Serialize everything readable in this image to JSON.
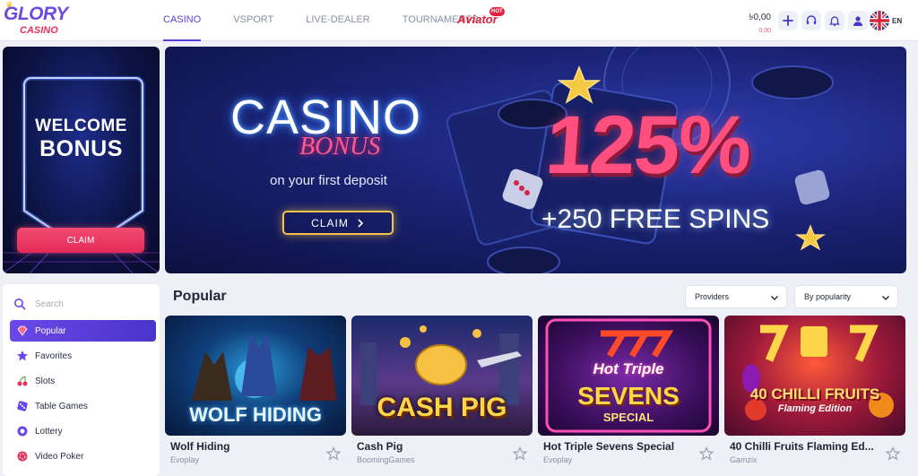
{
  "header": {
    "logo_top": "GLORY",
    "logo_bottom": "CASINO",
    "nav": [
      {
        "label": "CASINO",
        "active": true
      },
      {
        "label": "VSPORT",
        "active": false
      },
      {
        "label": "LIVE-DEALER",
        "active": false
      },
      {
        "label": "TOURNAMENTS",
        "active": false
      }
    ],
    "aviator": "Aviator",
    "aviator_badge": "HOT",
    "balance": "৳0,00",
    "bonus_balance": "0,00",
    "language": "EN"
  },
  "welcome": {
    "line1": "WELCOME",
    "line2": "BONUS",
    "claim": "CLAIM"
  },
  "banner": {
    "casino": "CASINO",
    "bonus": "BONUS",
    "subtitle": "on your first deposit",
    "claim": "CLAIM",
    "percent": "125%",
    "spins": "+250 FREE SPINS"
  },
  "sidebar": {
    "search_placeholder": "Search",
    "categories": [
      {
        "label": "Popular",
        "icon": "diamond-icon",
        "active": true
      },
      {
        "label": "Favorites",
        "icon": "star-icon",
        "active": false
      },
      {
        "label": "Slots",
        "icon": "cherries-icon",
        "active": false
      },
      {
        "label": "Table Games",
        "icon": "dice-icon",
        "active": false
      },
      {
        "label": "Lottery",
        "icon": "lottery-ball-icon",
        "active": false
      },
      {
        "label": "Video Poker",
        "icon": "poker-chip-icon",
        "active": false
      }
    ]
  },
  "games": {
    "section_title": "Popular",
    "providers_filter": "Providers",
    "sort_filter": "By popularity",
    "items": [
      {
        "name": "Wolf Hiding",
        "provider": "Evoplay",
        "art": "WOLF HIDING"
      },
      {
        "name": "Cash Pig",
        "provider": "BoomingGames",
        "art": "CASH PIG"
      },
      {
        "name": "Hot Triple Sevens Special",
        "provider": "Evoplay",
        "art1": "Hot Triple",
        "art2": "SEVENS",
        "art3": "SPECIAL"
      },
      {
        "name": "40 Chilli Fruits Flaming Ed...",
        "provider": "Gamzix",
        "art1": "40 CHILLI FRUITS",
        "art2": "Flaming Edition"
      }
    ]
  }
}
